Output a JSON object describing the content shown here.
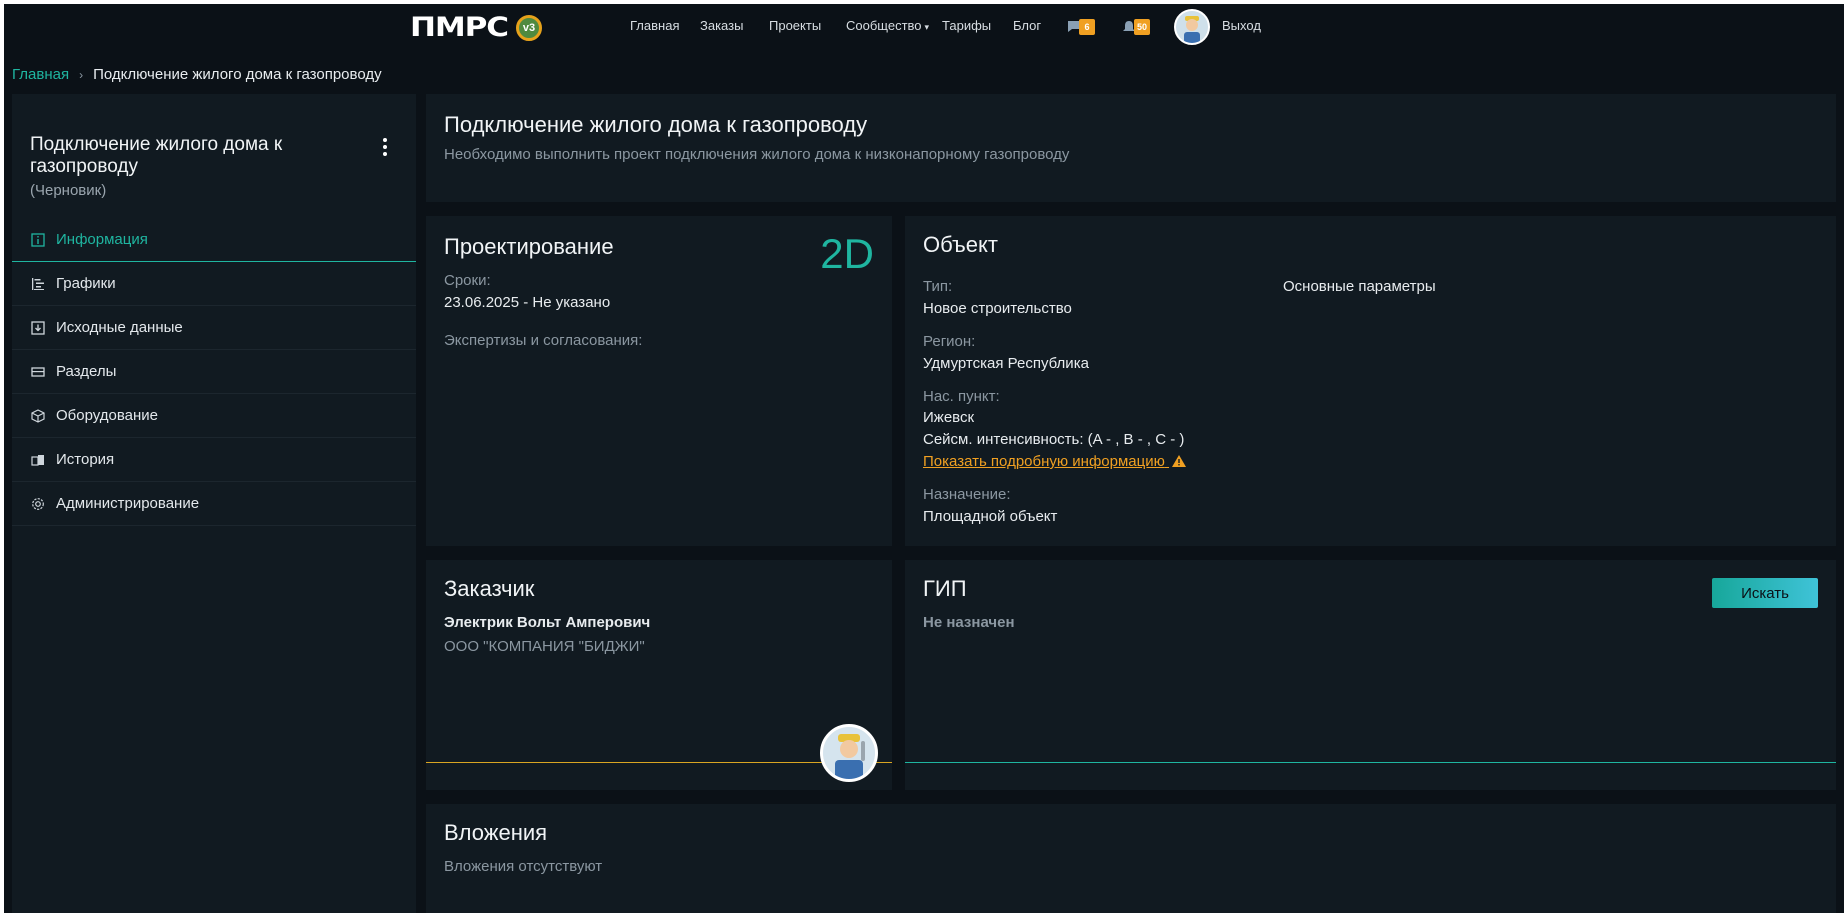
{
  "header": {
    "logo_text": "ПМРС",
    "logo_badge": "v3",
    "nav": {
      "home": "Главная",
      "orders": "Заказы",
      "projects": "Проекты",
      "community": "Сообщество",
      "tariffs": "Тарифы",
      "blog": "Блог",
      "logout": "Выход"
    },
    "messages_count": "6",
    "notifications_count": "50",
    "icons": [
      "chat-icon",
      "bell-icon",
      "avatar"
    ],
    "accent_color": "#f0a022"
  },
  "breadcrumb": {
    "home": "Главная",
    "current": "Подключение жилого дома к газопроводу"
  },
  "sidebar": {
    "title": "Подключение жилого дома к газопроводу",
    "status": "(Черновик)",
    "items": [
      {
        "label": "Информация",
        "icon": "info-icon"
      },
      {
        "label": "Графики",
        "icon": "gantt-icon"
      },
      {
        "label": "Исходные данные",
        "icon": "download-icon"
      },
      {
        "label": "Разделы",
        "icon": "sections-icon"
      },
      {
        "label": "Оборудование",
        "icon": "box-icon"
      },
      {
        "label": "История",
        "icon": "history-icon"
      },
      {
        "label": "Администрирование",
        "icon": "gear-icon"
      }
    ]
  },
  "project": {
    "title": "Подключение жилого дома к газопроводу",
    "description": "Необходимо выполнить проект подключения жилого дома к низконапорному газопроводу"
  },
  "design": {
    "title": "Проектирование",
    "badge": "2D",
    "terms_label": "Сроки:",
    "terms_value": "23.06.2025 - Не указано",
    "expertise_label": "Экспертизы и согласования:"
  },
  "object": {
    "title": "Объект",
    "type_label": "Тип:",
    "type_value": "Новое строительство",
    "main_params": "Основные параметры",
    "region_label": "Регион:",
    "region_value": "Удмуртская Республика",
    "locality_label": "Нас. пункт:",
    "locality_value": "Ижевск",
    "seismic": "Сейсм. интенсивность: (A - , B - , C - )",
    "details_link": "Показать подробную информацию",
    "purpose_label": "Назначение:",
    "purpose_value": "Площадной объект"
  },
  "customer": {
    "title": "Заказчик",
    "name": "Электрик Вольт Амперович",
    "company": "ООО \"КОМПАНИЯ \"БИДЖИ\""
  },
  "gip": {
    "title": "ГИП",
    "status": "Не назначен",
    "search_button": "Искать"
  },
  "attachments": {
    "title": "Вложения",
    "empty": "Вложения отсутствуют"
  },
  "colors": {
    "background": "#0b1117",
    "card": "#111a21",
    "teal": "#1fb5a0",
    "gold": "#d9a522",
    "warning": "#f0a022"
  }
}
